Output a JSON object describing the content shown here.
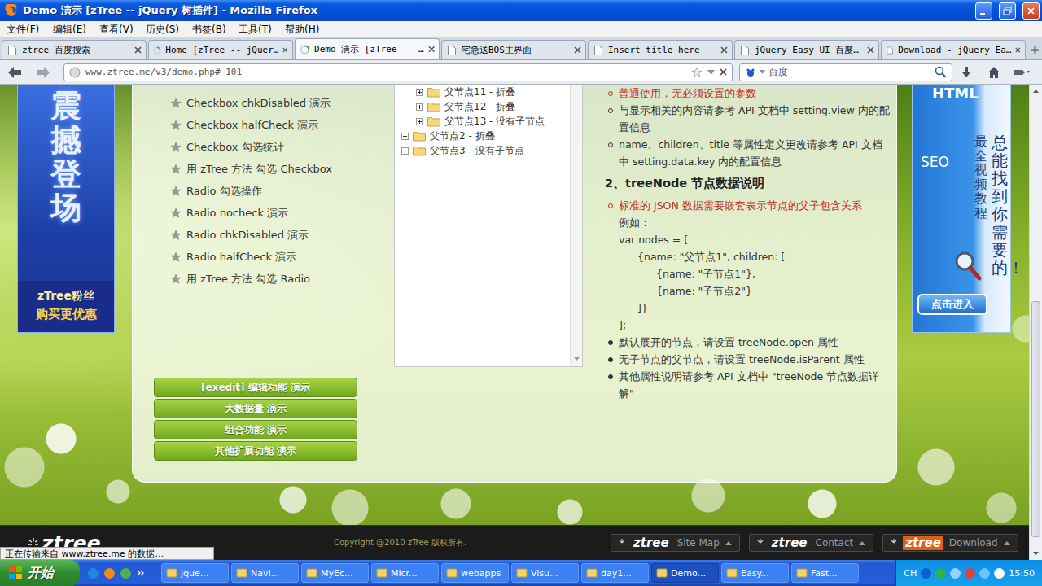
{
  "window": {
    "title": "Demo 演示 [zTree -- jQuery 树插件] - Mozilla Firefox"
  },
  "menu": [
    "文件(F)",
    "编辑(E)",
    "查看(V)",
    "历史(S)",
    "书签(B)",
    "工具(T)",
    "帮助(H)"
  ],
  "tabs": [
    {
      "label": "ztree_百度搜索",
      "selected": false,
      "loading": false
    },
    {
      "label": "Home [zTree -- jQuer…",
      "selected": false,
      "loading": true
    },
    {
      "label": "Demo 演示 [zTree -- …",
      "selected": true,
      "loading": true
    },
    {
      "label": "宅急送BOS主界面",
      "selected": false,
      "loading": false
    },
    {
      "label": "Insert title here",
      "selected": false,
      "loading": false
    },
    {
      "label": "jQuery Easy UI_百度…",
      "selected": false,
      "loading": false
    },
    {
      "label": "Download - jQuery Ea…",
      "selected": false,
      "loading": false
    }
  ],
  "address": {
    "url": "www.ztree.me/v3/demo.php#_101"
  },
  "search": {
    "placeholder": "百度"
  },
  "left_ad": {
    "headline": "震撼登场",
    "caption": [
      "zTree粉丝",
      "购买更优惠"
    ]
  },
  "right_ad": {
    "badge": "HTML",
    "tag": "SEO",
    "subtitle": "最全视频教程",
    "slogan": "总能找到你需要的！",
    "button": "点击进入"
  },
  "demo_list": [
    "Checkbox chkDisabled 演示",
    "Checkbox halfCheck 演示",
    "Checkbox 勾选统计",
    "用 zTree 方法 勾选 Checkbox",
    "Radio 勾选操作",
    "Radio nocheck 演示",
    "Radio chkDisabled 演示",
    "Radio halfCheck 演示",
    "用 zTree 方法 勾选 Radio"
  ],
  "tree": [
    {
      "label": "父节点11 - 折叠",
      "depth": 1,
      "expanded": false
    },
    {
      "label": "父节点12 - 折叠",
      "depth": 1,
      "expanded": false
    },
    {
      "label": "父节点13 - 没有子节点",
      "depth": 1,
      "expanded": false
    },
    {
      "label": "父节点2 - 折叠",
      "depth": 0,
      "expanded": false
    },
    {
      "label": "父节点3 - 没有子节点",
      "depth": 0,
      "expanded": false
    }
  ],
  "doc": [
    {
      "kind": "bullet",
      "text": "普通使用，无必须设置的参数",
      "highlight": true
    },
    {
      "kind": "bullet",
      "text": "与显示相关的内容请参考 API 文档中 setting.view 内的配置信息",
      "highlight": false
    },
    {
      "kind": "bullet",
      "text": "name、children、title 等属性定义更改请参考 API 文档中 setting.data.key 内的配置信息",
      "highlight": false
    },
    {
      "kind": "heading",
      "text": "2、treeNode 节点数据说明"
    },
    {
      "kind": "bullet",
      "text": "标准的 JSON 数据需要嵌套表示节点的父子包含关系",
      "highlight": true
    },
    {
      "kind": "plain",
      "text": "例如：",
      "depth": 0
    },
    {
      "kind": "plain",
      "text": "var nodes = [",
      "depth": 0
    },
    {
      "kind": "plain",
      "text": "{name: \"父节点1\", children: [",
      "depth": 1
    },
    {
      "kind": "plain",
      "text": "{name: \"子节点1\"},",
      "depth": 2
    },
    {
      "kind": "plain",
      "text": "{name: \"子节点2\"}",
      "depth": 2
    },
    {
      "kind": "plain",
      "text": "]}",
      "depth": 1
    },
    {
      "kind": "plain",
      "text": "];",
      "depth": 0
    },
    {
      "kind": "dot",
      "text": "默认展开的节点，请设置 treeNode.open 属性",
      "highlight": false
    },
    {
      "kind": "dot",
      "text": "无子节点的父节点，请设置 treeNode.isParent 属性",
      "highlight": false
    },
    {
      "kind": "dot",
      "text": "其他属性说明请参考 API 文档中 \"treeNode 节点数据详解\"",
      "highlight": false
    }
  ],
  "demo_buttons": [
    "[exedit] 编辑功能 演示",
    "大数据量 演示",
    "组合功能 演示",
    "其他扩展功能 演示"
  ],
  "footer": {
    "logo": "ztree",
    "copyright": "Copyright @2010 zTree 版权所有.",
    "links": [
      {
        "brand": "ztree",
        "label": "Site Map",
        "highlight": false
      },
      {
        "brand": "ztree",
        "label": "Contact",
        "highlight": false
      },
      {
        "brand": "ztree",
        "label": "Download",
        "highlight": true
      }
    ]
  },
  "status_bar": "正在传输来自 www.ztree.me 的数据…",
  "taskbar": {
    "start": "开始",
    "tasks": [
      {
        "label": "jque...",
        "selected": false
      },
      {
        "label": "Navi...",
        "selected": false
      },
      {
        "label": "MyEc...",
        "selected": false
      },
      {
        "label": "Micr...",
        "selected": false
      },
      {
        "label": "webapps",
        "selected": false
      },
      {
        "label": "Visu...",
        "selected": false
      },
      {
        "label": "day1...",
        "selected": false
      },
      {
        "label": "Demo...",
        "selected": true
      },
      {
        "label": "Easy...",
        "selected": false
      },
      {
        "label": "Fast...",
        "selected": false
      }
    ],
    "tray": {
      "lang": "CH",
      "time": "15:50"
    }
  }
}
